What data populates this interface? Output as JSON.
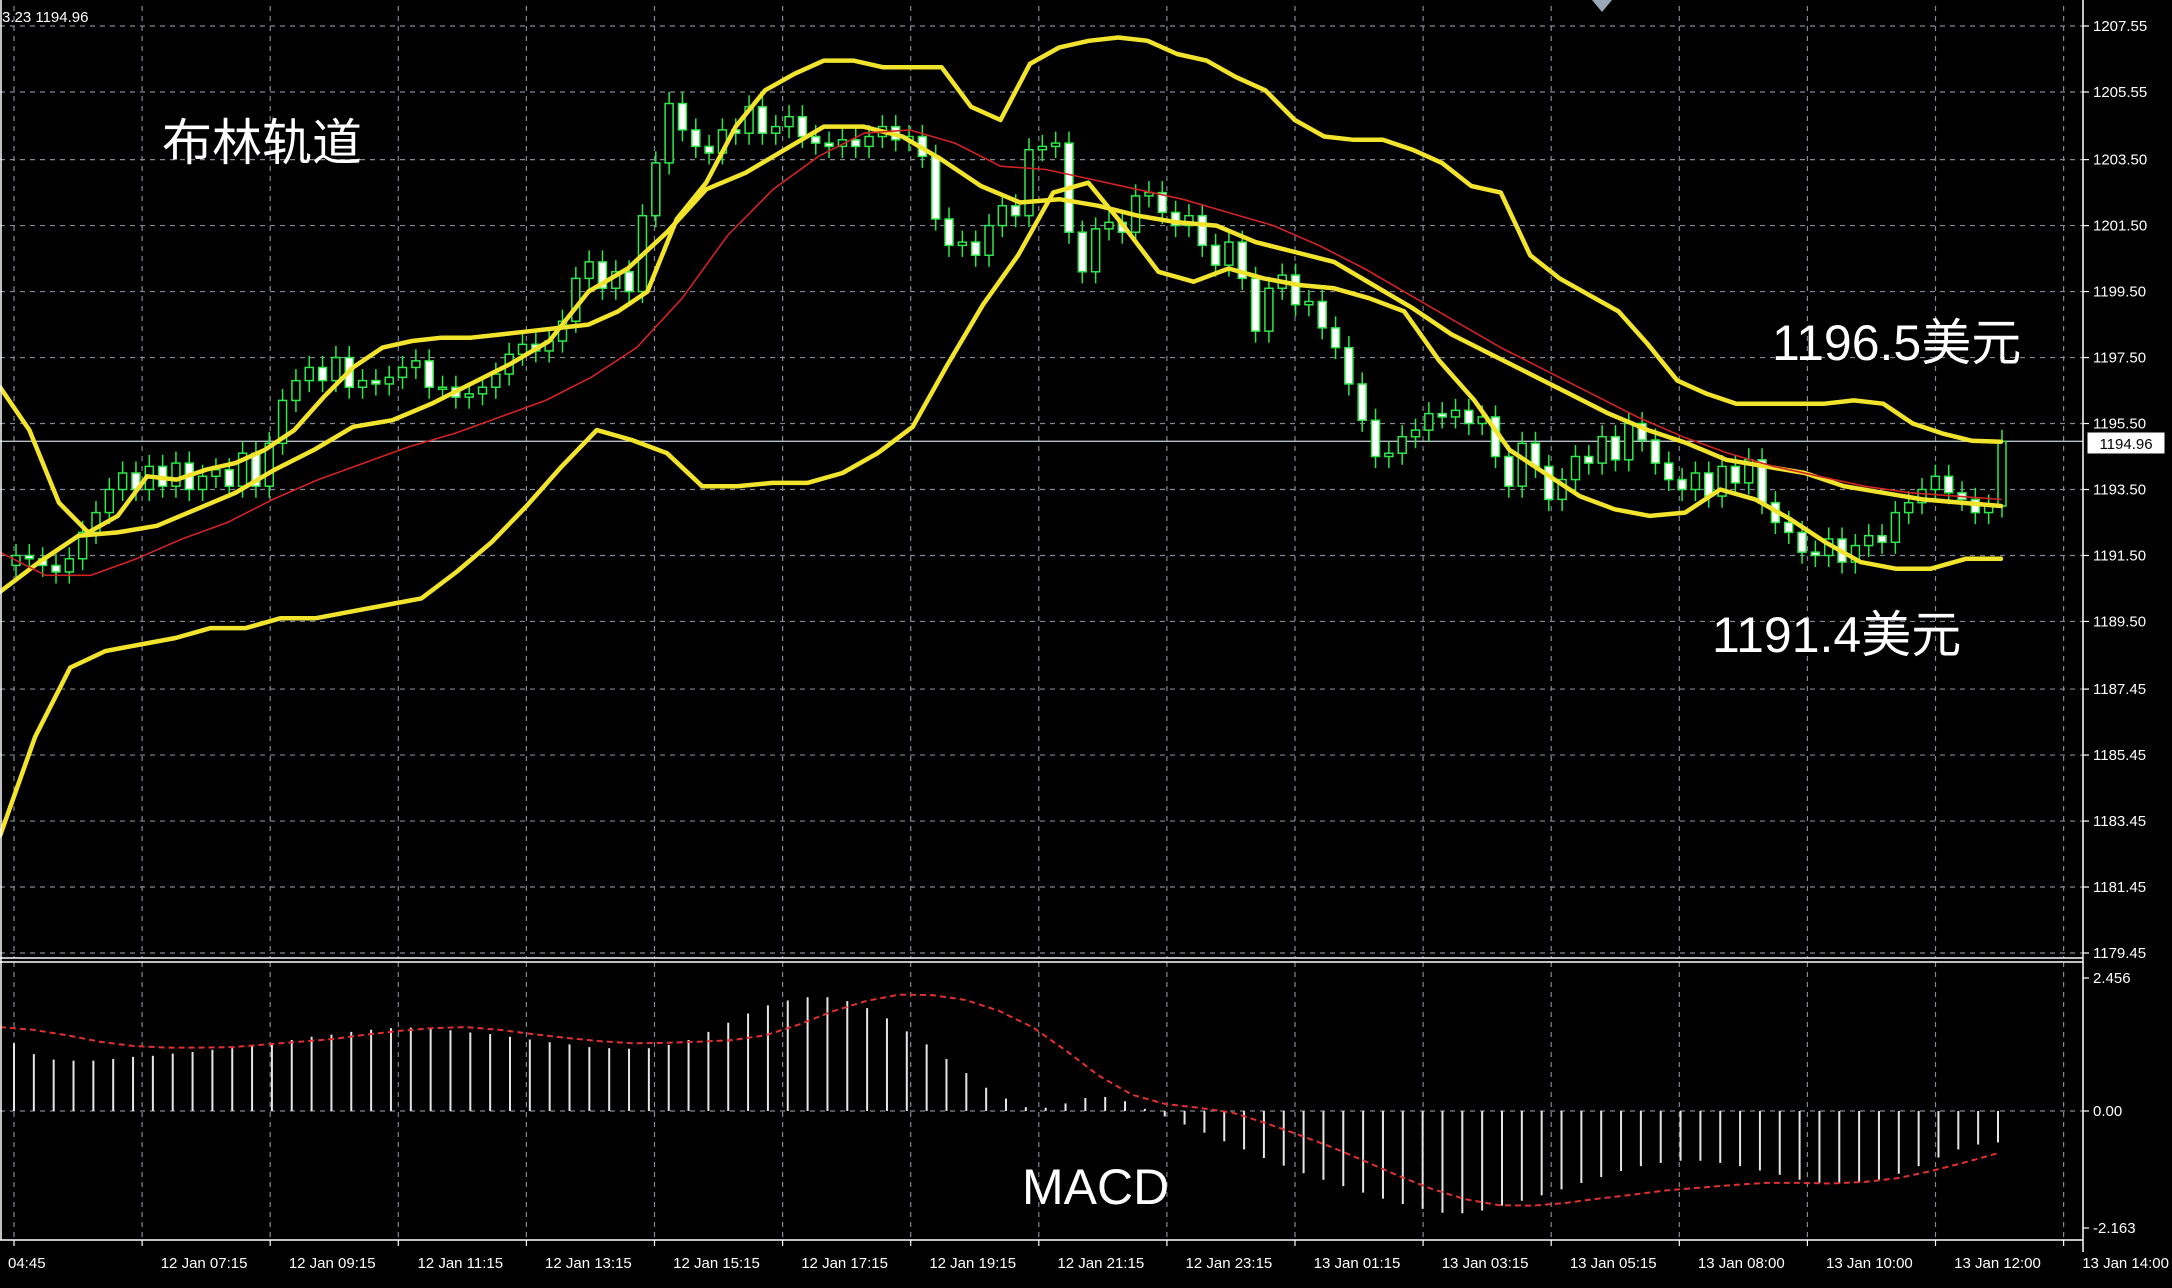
{
  "header": {
    "readout": "3.23 1194.96"
  },
  "annotations": {
    "title": "布林轨道",
    "upper_value": "1196.5美元",
    "lower_value": "1191.4美元",
    "macd_label": "MACD"
  },
  "price_tag": "1194.96",
  "chart_data": [
    {
      "type": "candlestick",
      "panel": "price",
      "ylim": [
        1179.45,
        1207.55
      ],
      "y_ticks": [
        "1207.55",
        "1205.55",
        "1203.50",
        "1201.50",
        "1199.50",
        "1197.50",
        "1195.50",
        "1193.50",
        "1191.50",
        "1189.50",
        "1187.45",
        "1185.45",
        "1183.45",
        "1181.45",
        "1179.45"
      ],
      "current_price": 1194.96,
      "x_ticks": [
        "04:45",
        "12 Jan 07:15",
        "12 Jan 09:15",
        "12 Jan 11:15",
        "12 Jan 13:15",
        "12 Jan 15:15",
        "12 Jan 17:15",
        "12 Jan 19:15",
        "12 Jan 21:15",
        "12 Jan 23:15",
        "13 Jan 01:15",
        "13 Jan 03:15",
        "13 Jan 05:15",
        "13 Jan 08:00",
        "13 Jan 10:00",
        "13 Jan 12:00",
        "13 Jan 14:00"
      ],
      "close": [
        1191.5,
        1191.4,
        1191.2,
        1191.0,
        1191.4,
        1192.2,
        1192.8,
        1193.5,
        1194.0,
        1193.5,
        1194.2,
        1193.6,
        1194.3,
        1193.5,
        1193.9,
        1194.1,
        1193.6,
        1194.6,
        1193.6,
        1194.9,
        1196.2,
        1196.8,
        1197.2,
        1196.8,
        1197.5,
        1196.6,
        1196.8,
        1196.7,
        1196.9,
        1197.2,
        1197.4,
        1196.6,
        1196.6,
        1196.3,
        1196.4,
        1196.6,
        1197.0,
        1197.6,
        1197.9,
        1197.7,
        1198.0,
        1198.6,
        1199.9,
        1200.4,
        1199.6,
        1200.1,
        1199.5,
        1201.8,
        1203.4,
        1205.2,
        1204.4,
        1203.9,
        1203.7,
        1204.4,
        1204.3,
        1205.1,
        1204.3,
        1204.5,
        1204.8,
        1204.2,
        1204.0,
        1203.9,
        1204.1,
        1203.9,
        1204.2,
        1204.5,
        1204.1,
        1204.2,
        1203.6,
        1201.7,
        1200.9,
        1201.0,
        1200.6,
        1201.5,
        1202.1,
        1201.8,
        1203.8,
        1203.9,
        1204.0,
        1201.3,
        1200.1,
        1201.4,
        1201.6,
        1201.3,
        1202.4,
        1202.5,
        1201.9,
        1201.5,
        1201.8,
        1200.9,
        1200.3,
        1201.0,
        1199.9,
        1198.3,
        1199.6,
        1200.0,
        1199.1,
        1199.2,
        1198.4,
        1197.8,
        1196.7,
        1195.6,
        1194.5,
        1194.6,
        1195.1,
        1195.3,
        1195.8,
        1195.7,
        1195.9,
        1195.5,
        1195.7,
        1194.5,
        1193.6,
        1194.9,
        1194.2,
        1193.2,
        1193.8,
        1194.5,
        1194.3,
        1195.1,
        1194.4,
        1195.5,
        1195.0,
        1194.3,
        1193.8,
        1193.5,
        1194.0,
        1193.3,
        1194.2,
        1193.7,
        1194.4,
        1193.1,
        1192.5,
        1192.2,
        1191.6,
        1191.5,
        1192.0,
        1191.3,
        1191.8,
        1192.1,
        1191.9,
        1192.8,
        1193.1,
        1193.5,
        1193.9,
        1193.4,
        1193.2,
        1192.8,
        1193.0,
        1194.96
      ],
      "series": [
        {
          "name": "upper_band",
          "color": "#f2e42c",
          "values": [
            1196.6,
            1195.3,
            1193.1,
            1192.2,
            1192.7,
            1193.9,
            1193.8,
            1194.1,
            1194.3,
            1194.7,
            1195.3,
            1196.3,
            1197.2,
            1197.8,
            1198.0,
            1198.1,
            1198.1,
            1198.2,
            1198.3,
            1198.4,
            1198.5,
            1198.9,
            1199.5,
            1201.7,
            1202.8,
            1204.5,
            1205.6,
            1206.1,
            1206.5,
            1206.5,
            1206.3,
            1206.3,
            1206.3,
            1205.1,
            1204.7,
            1206.4,
            1206.9,
            1207.1,
            1207.2,
            1207.1,
            1206.7,
            1206.5,
            1206.0,
            1205.6,
            1204.7,
            1204.2,
            1204.1,
            1204.1,
            1203.8,
            1203.4,
            1202.7,
            1202.5,
            1200.6,
            1199.9,
            1199.4,
            1198.9,
            1197.9,
            1196.8,
            1196.4,
            1196.1,
            1196.1,
            1196.1,
            1196.1,
            1196.2,
            1196.1,
            1195.5,
            1195.2,
            1194.98,
            1194.95
          ]
        },
        {
          "name": "middle_band",
          "color": "#f2e42c",
          "values": [
            1190.4,
            1191.3,
            1192.1,
            1192.2,
            1192.4,
            1192.9,
            1193.4,
            1194.1,
            1194.7,
            1195.4,
            1195.6,
            1196.1,
            1196.7,
            1197.3,
            1198.0,
            1199.5,
            1200.2,
            1201.3,
            1202.6,
            1203.1,
            1203.8,
            1204.5,
            1204.5,
            1204.2,
            1203.5,
            1202.7,
            1202.2,
            1202.3,
            1202.1,
            1201.8,
            1201.6,
            1201.5,
            1201.0,
            1200.7,
            1200.4,
            1199.7,
            1199.0,
            1198.2,
            1197.6,
            1197.0,
            1196.4,
            1195.8,
            1195.3,
            1194.9,
            1194.4,
            1194.2,
            1194.0,
            1193.6,
            1193.4,
            1193.2,
            1193.1,
            1193.0
          ]
        },
        {
          "name": "lower_band",
          "color": "#f2e42c",
          "values": [
            1183.0,
            1186.0,
            1188.1,
            1188.6,
            1188.8,
            1189.0,
            1189.3,
            1189.3,
            1189.6,
            1189.6,
            1189.8,
            1190.0,
            1190.2,
            1191.0,
            1191.9,
            1193.0,
            1194.2,
            1195.3,
            1195.0,
            1194.6,
            1193.6,
            1193.6,
            1193.7,
            1193.7,
            1194.0,
            1194.6,
            1195.4,
            1197.3,
            1199.1,
            1200.6,
            1202.5,
            1202.8,
            1201.5,
            1200.1,
            1199.8,
            1200.2,
            1199.9,
            1199.7,
            1199.6,
            1199.3,
            1198.9,
            1197.4,
            1196.2,
            1194.7,
            1194.0,
            1193.3,
            1192.9,
            1192.7,
            1192.8,
            1193.5,
            1193.2,
            1192.6,
            1191.9,
            1191.3,
            1191.1,
            1191.1,
            1191.4,
            1191.4
          ]
        },
        {
          "name": "moving_average",
          "color": "#d12323",
          "values": [
            1191.6,
            1190.9,
            1190.9,
            1191.4,
            1192.0,
            1192.5,
            1193.2,
            1193.8,
            1194.3,
            1194.8,
            1195.2,
            1195.7,
            1196.2,
            1196.9,
            1197.8,
            1199.3,
            1201.2,
            1202.6,
            1203.6,
            1204.3,
            1204.4,
            1204.0,
            1203.3,
            1203.2,
            1202.9,
            1202.6,
            1202.3,
            1201.9,
            1201.5,
            1200.9,
            1200.2,
            1199.4,
            1198.6,
            1197.8,
            1197.1,
            1196.4,
            1195.7,
            1195.1,
            1194.6,
            1194.2,
            1193.9,
            1193.6,
            1193.4,
            1193.3,
            1193.2
          ]
        }
      ]
    },
    {
      "type": "bar",
      "panel": "macd",
      "ylim": [
        -2.163,
        2.456
      ],
      "y_ticks": [
        "2.456",
        "0.00",
        "-2.163"
      ],
      "histogram": [
        1.25,
        1.05,
        0.95,
        0.93,
        0.93,
        0.96,
        1.0,
        1.02,
        1.06,
        1.09,
        1.13,
        1.16,
        1.2,
        1.25,
        1.31,
        1.37,
        1.41,
        1.46,
        1.5,
        1.53,
        1.54,
        1.52,
        1.49,
        1.45,
        1.42,
        1.37,
        1.32,
        1.27,
        1.23,
        1.18,
        1.16,
        1.15,
        1.16,
        1.22,
        1.31,
        1.46,
        1.63,
        1.8,
        1.95,
        2.04,
        2.1,
        2.1,
        2.03,
        1.9,
        1.71,
        1.47,
        1.23,
        0.96,
        0.7,
        0.43,
        0.23,
        0.07,
        0.06,
        0.14,
        0.24,
        0.26,
        0.18,
        0.04,
        -0.1,
        -0.25,
        -0.4,
        -0.56,
        -0.71,
        -0.87,
        -1.01,
        -1.15,
        -1.27,
        -1.39,
        -1.51,
        -1.62,
        -1.72,
        -1.81,
        -1.88,
        -1.89,
        -1.84,
        -1.75,
        -1.66,
        -1.56,
        -1.45,
        -1.33,
        -1.22,
        -1.11,
        -1.02,
        -0.96,
        -0.92,
        -0.92,
        -0.96,
        -1.02,
        -1.1,
        -1.18,
        -1.27,
        -1.33,
        -1.34,
        -1.32,
        -1.27,
        -1.16,
        -1.02,
        -0.86,
        -0.71,
        -0.62,
        -0.58
      ],
      "signal": [
        1.55,
        1.5,
        1.4,
        1.28,
        1.2,
        1.17,
        1.17,
        1.18,
        1.23,
        1.28,
        1.33,
        1.41,
        1.48,
        1.53,
        1.55,
        1.5,
        1.42,
        1.35,
        1.29,
        1.25,
        1.26,
        1.28,
        1.31,
        1.4,
        1.6,
        1.84,
        2.03,
        2.15,
        2.14,
        2.05,
        1.85,
        1.55,
        1.12,
        0.65,
        0.3,
        0.13,
        0.06,
        -0.03,
        -0.22,
        -0.44,
        -0.67,
        -0.93,
        -1.2,
        -1.44,
        -1.63,
        -1.74,
        -1.75,
        -1.7,
        -1.62,
        -1.55,
        -1.47,
        -1.42,
        -1.37,
        -1.33,
        -1.33,
        -1.34,
        -1.31,
        -1.24,
        -1.11,
        -0.95,
        -0.78
      ]
    }
  ]
}
